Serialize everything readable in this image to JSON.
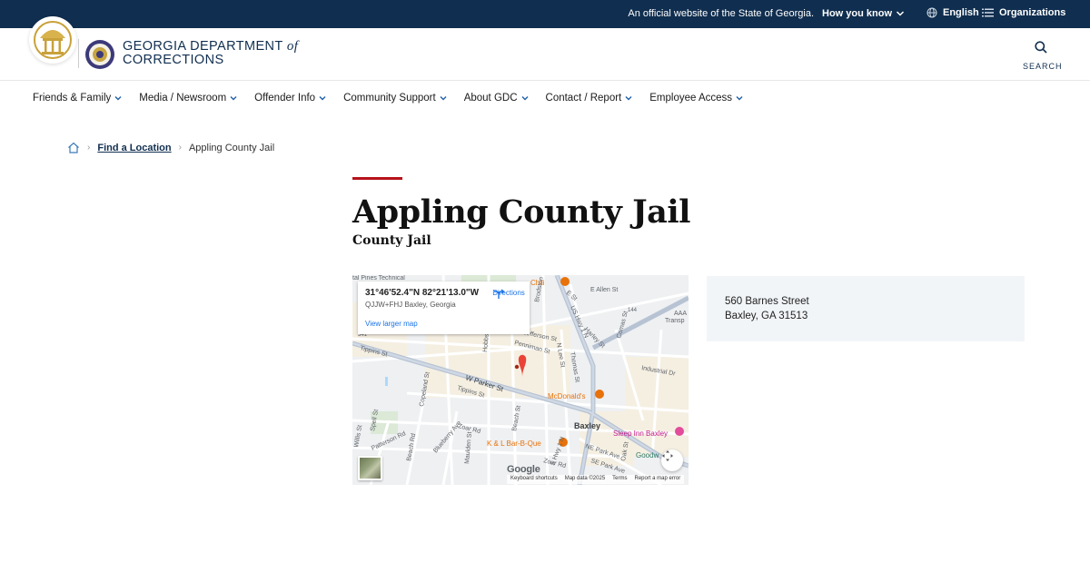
{
  "topbar": {
    "official": "An official website of the State of Georgia.",
    "how_you_know": "How you know",
    "language": "English",
    "organizations": "Organizations"
  },
  "header": {
    "brand_line1": "GEORGIA DEPARTMENT",
    "brand_of": "of",
    "brand_line2": "CORRECTIONS",
    "search_label": "SEARCH"
  },
  "nav": {
    "items": [
      {
        "label": "Friends & Family"
      },
      {
        "label": "Media / Newsroom"
      },
      {
        "label": "Offender Info"
      },
      {
        "label": "Community Support"
      },
      {
        "label": "About GDC"
      },
      {
        "label": "Contact / Report"
      },
      {
        "label": "Employee Access"
      }
    ]
  },
  "breadcrumb": {
    "link": "Find a Location",
    "current": "Appling County Jail"
  },
  "page": {
    "title": "Appling County Jail",
    "subtitle": "County Jail"
  },
  "map": {
    "coords": "31°46'52.4\"N 82°21'13.0\"W",
    "plus_code": "QJJW+FHJ Baxley, Georgia",
    "view_larger": "View larger map",
    "directions": "Directions",
    "google": "Google",
    "footer": {
      "shortcuts": "Keyboard shortcuts",
      "map_data": "Map data ©2025",
      "terms": "Terms",
      "report": "Report a map error"
    },
    "labels": {
      "pines": "tal Pines Technical",
      "chili": "Chili",
      "e_allen": "E Allen St",
      "e_st": "E St",
      "brodston": "Brodston St",
      "us_hwy": "US Hwy 1 N",
      "harley": "Harley St",
      "n_lee": "N Lee St",
      "thomas": "Thomas St",
      "comas": "Comas St",
      "industrial": "Industrial Dr",
      "aaa": "AAA",
      "transp": "Transp",
      "tippins_w": "Tippins St",
      "tippins": "Tippins St",
      "w_parker": "W Parker St",
      "hobbs": "Hobbs St",
      "penniman": "Penniman St",
      "jefferson": "Jefferson St",
      "mcdonalds": "McDonald's",
      "copeland": "Copeland St",
      "baxley": "Baxley",
      "sleep_inn": "Sleep Inn Baxley",
      "goodw": "Goodw",
      "zoar": "Zoar Rd",
      "zoar2": "Zoar Rd",
      "blueberry": "Blueberry Ave",
      "patterson": "Patterson Rd",
      "spell": "Spell St",
      "beach": "Beach Rd",
      "maulden": "Maulden St",
      "kl_bbq": "K & L Bar-B-Que",
      "ne_park": "NE Park Ave",
      "se_park": "SE Park Ave",
      "oak": "Oak St",
      "hwy_144": "144",
      "hwy_341": "341",
      "willis": "Willis St",
      "beach_st": "Beach St",
      "s_hwy": "S Hwy 1 N"
    }
  },
  "address": {
    "line1": "560 Barnes Street",
    "line2": "Baxley, GA 31513"
  },
  "colors": {
    "navy": "#102e4f",
    "accent_red": "#b5121b",
    "address_bg": "#f2f5f8"
  }
}
